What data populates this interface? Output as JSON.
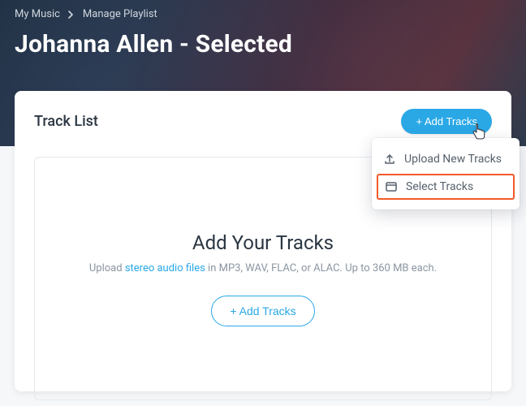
{
  "breadcrumb": {
    "root": "My Music",
    "current": "Manage Playlist"
  },
  "page_title": "Johanna Allen - Selected",
  "card": {
    "title": "Track List",
    "add_button": "+ Add Tracks"
  },
  "dropzone": {
    "title": "Add Your Tracks",
    "sub_prefix": "Upload ",
    "sub_link": "stereo audio files",
    "sub_suffix": " in MP3, WAV, FLAC, or ALAC. Up to 360 MB each.",
    "cta": "+ Add Tracks"
  },
  "popover": {
    "upload": "Upload New Tracks",
    "select": "Select Tracks"
  }
}
